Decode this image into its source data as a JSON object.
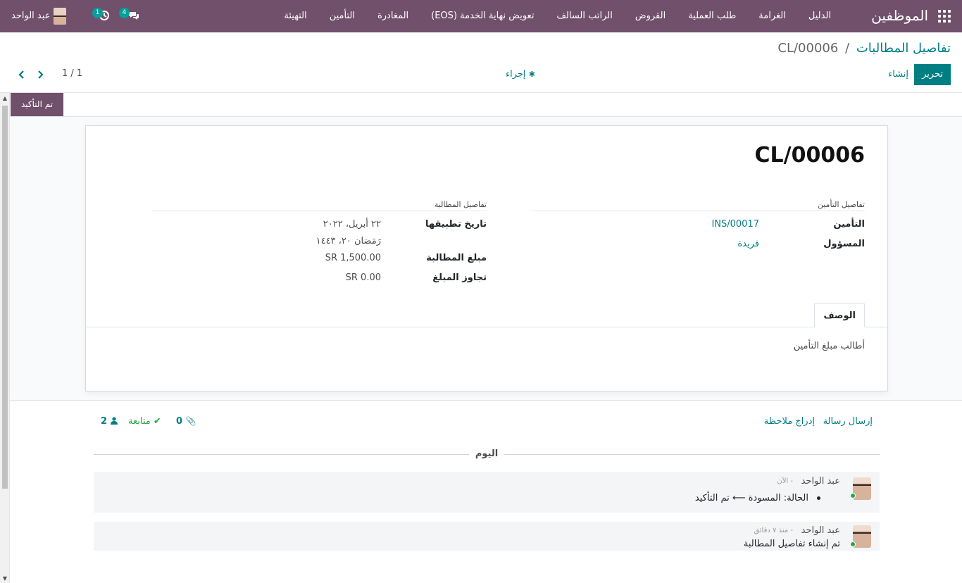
{
  "navbar": {
    "brand": "الموظفين",
    "menu": [
      "الدليل",
      "الغرامة",
      "طلب العملية",
      "القروض",
      "الراتب السالف",
      "تعويض نهاية الخدمة (EOS)",
      "المغادرة",
      "التأمين",
      "التهيئة"
    ],
    "user_name": "عبد الواحد",
    "chat_badge": "4",
    "activity_badge": "1"
  },
  "breadcrumb": {
    "parent": "تفاصيل المطالبات",
    "separator": "/",
    "current": "CL/00006"
  },
  "buttons": {
    "edit": "تحرير",
    "create": "إنشاء",
    "action": "إجراء"
  },
  "pager": {
    "value": "1 / 1"
  },
  "status": {
    "label": "تم التأكيد"
  },
  "record": {
    "title": "CL/00006",
    "insurance_group_label": "تفاصيل التأمين",
    "claim_group_label": "تفاصيل المطالبة",
    "insurance_label": "التأمين",
    "insurance_value": "INS/00017",
    "responsible_label": "المسؤول",
    "responsible_value": "فريدة",
    "apply_date_label": "تاريخ تطبيقها",
    "apply_date_value": "٢٢ أبريل، ٢٠٢٢",
    "apply_date_hijri": "رَمَضان ٢٠، ١٤٤٣",
    "claim_amount_label": "مبلغ المطالبة",
    "claim_amount_value": "SR 1,500.00",
    "exceed_label": "تجاوز المبلغ",
    "exceed_value": "SR 0.00",
    "tab_description": "الوصف",
    "description": "أطالب مبلغ التأمين"
  },
  "chatter": {
    "send_message": "إرسال رسالة",
    "log_note": "إدراج ملاحظة",
    "attachments": "0",
    "follow": "متابعة",
    "followers": "2",
    "today": "اليوم",
    "messages": [
      {
        "author": "عبد الواحد",
        "time": "- الآن",
        "body": "الحالة: المسودة ⟵ تم التأكيد"
      },
      {
        "author": "عبد الواحد",
        "time": "- منذ ٧ دقائق",
        "body": "تم إنشاء تفاصيل المطالبة"
      }
    ]
  },
  "colors": {
    "navbar": "#71506b",
    "primary": "#017e84",
    "badge": "#00a09d"
  }
}
